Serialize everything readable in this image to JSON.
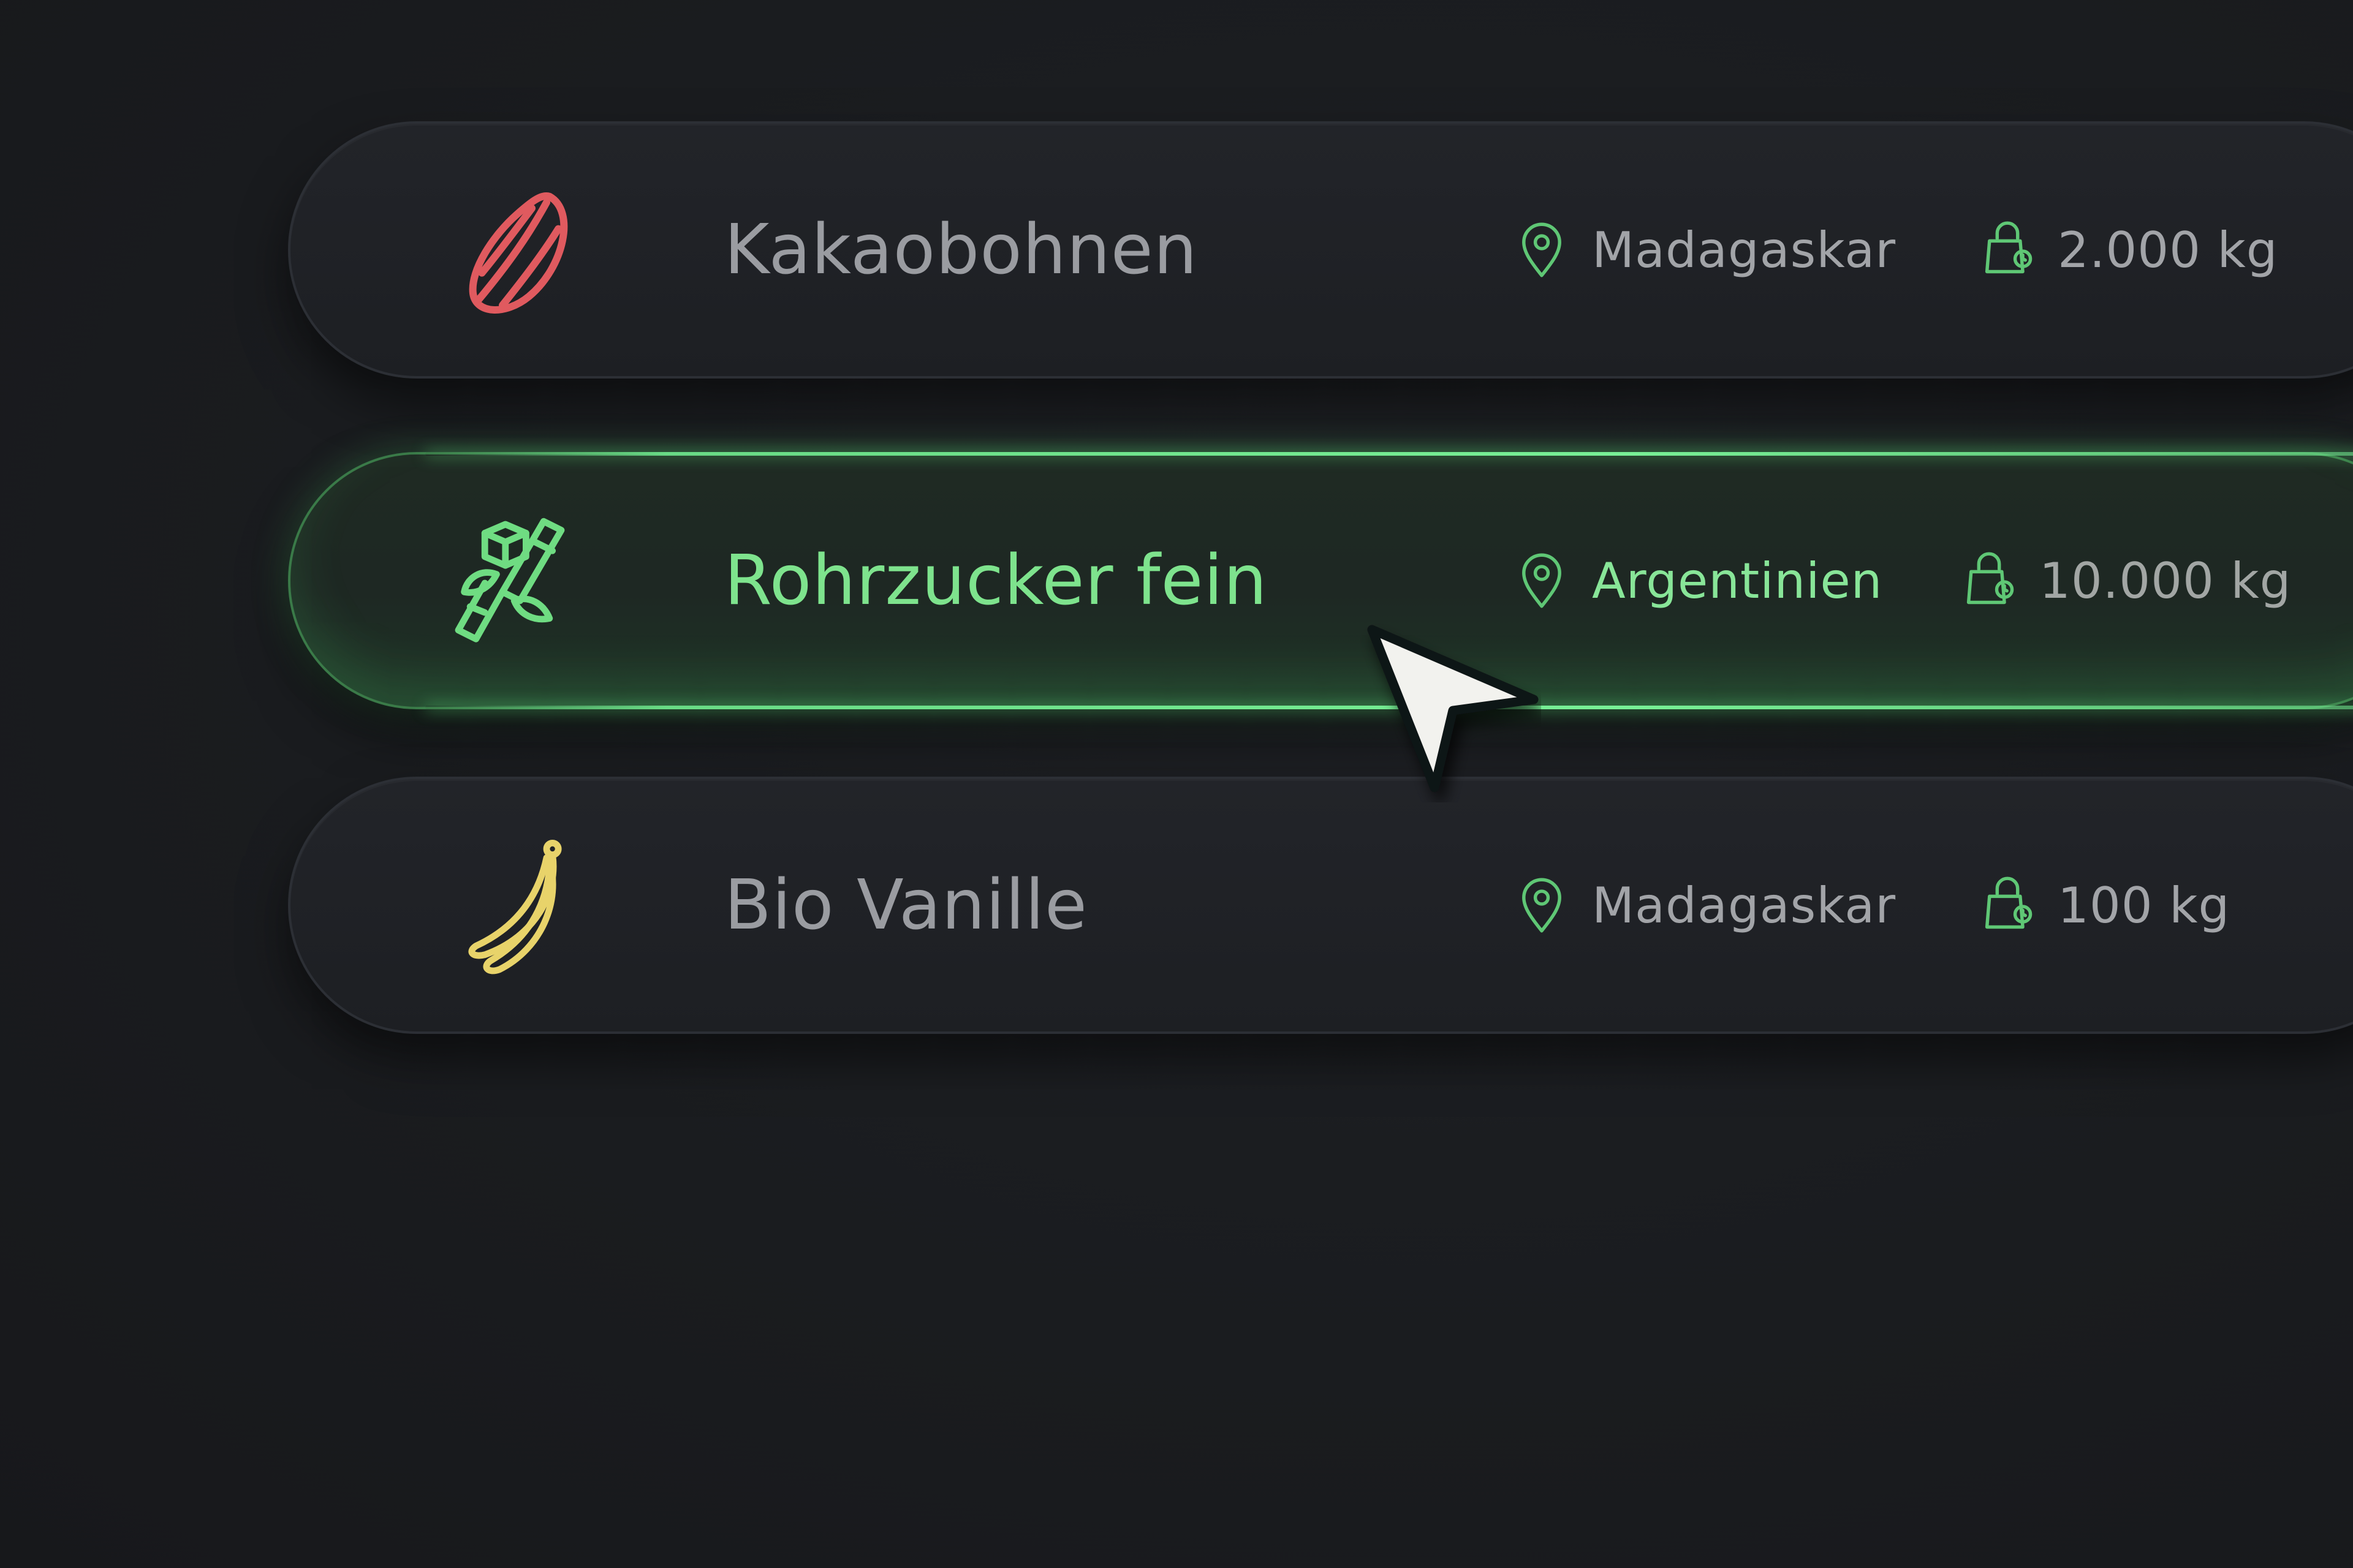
{
  "items": [
    {
      "name": "Kakaobohnen",
      "icon": "cocoa-bean-icon",
      "icon_color": "#e05a5f",
      "location_icon": "map-pin-icon",
      "location": "Madagaskar",
      "weight_icon": "weight-bag-icon",
      "weight": "2.000 kg",
      "state": "default"
    },
    {
      "name": "Rohrzucker fein",
      "icon": "sugarcane-cube-icon",
      "icon_color": "#6fdc82",
      "location_icon": "map-pin-icon",
      "location": "Argentinien",
      "weight_icon": "weight-bag-icon",
      "weight": "10.000 kg",
      "state": "hover"
    },
    {
      "name": "Bio Vanille",
      "icon": "vanilla-pod-icon",
      "icon_color": "#e8d36a",
      "location_icon": "map-pin-icon",
      "location": "Madagaskar",
      "weight_icon": "weight-bag-icon",
      "weight": "100 kg",
      "state": "default"
    }
  ],
  "colors": {
    "background": "#1a1c20",
    "accent_green": "#7ee38d",
    "meta_icon_green": "#5fc775",
    "text_muted": "#9a9ca1"
  },
  "cursor_icon": "mouse-pointer-icon"
}
